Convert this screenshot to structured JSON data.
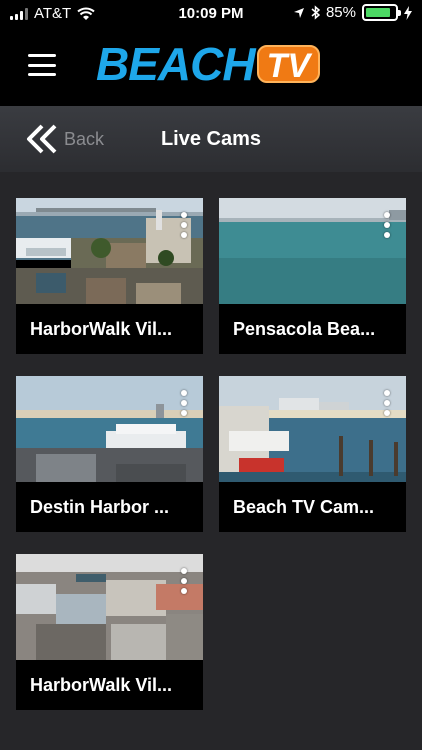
{
  "status_bar": {
    "carrier": "AT&T",
    "time": "10:09 PM",
    "battery": "85%",
    "battery_level": 0.85
  },
  "header": {
    "logo_main": "BEACH",
    "logo_tv": "TV"
  },
  "nav": {
    "back_label": "Back",
    "title": "Live Cams"
  },
  "cams": [
    {
      "title": "HarborWalk Vil..."
    },
    {
      "title": "Pensacola Bea..."
    },
    {
      "title": "Destin Harbor ..."
    },
    {
      "title": "Beach TV Cam..."
    },
    {
      "title": "HarborWalk Vil..."
    }
  ],
  "colors": {
    "background": "#262629",
    "accent_blue": "#1ea7ea",
    "accent_orange": "#f07a14",
    "battery_green": "#4cd964"
  }
}
